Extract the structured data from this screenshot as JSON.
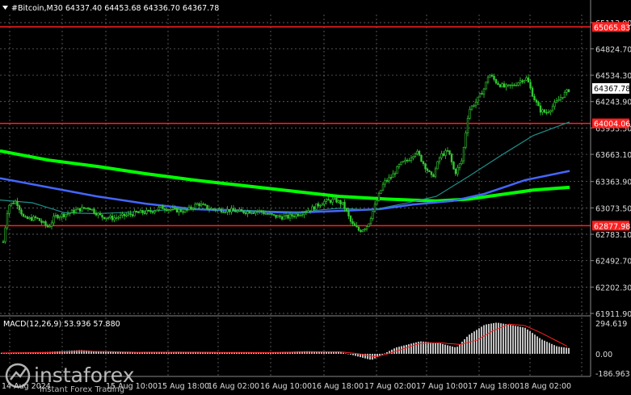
{
  "header": {
    "symbol_text": "#Bitcoin,M30  64337.40 64453.68 64336.70 64367.78",
    "macd_text": "MACD(12,26,9) 53.936 57.880"
  },
  "price_axis": {
    "labels": [
      "65113.00",
      "64824.70",
      "64534.30",
      "64243.90",
      "63953.50",
      "63663.10",
      "63363.90",
      "63073.50",
      "62783.10",
      "62492.70",
      "62202.30",
      "61911.90"
    ],
    "values": [
      65113.0,
      64824.7,
      64534.3,
      64243.9,
      63953.5,
      63663.1,
      63363.9,
      63073.5,
      62783.1,
      62492.7,
      62202.3,
      61911.9
    ],
    "current_price": "64367.78",
    "levels": [
      {
        "label": "65065.83",
        "value": 65065.83
      },
      {
        "label": "64004.06",
        "value": 64004.06
      },
      {
        "label": "62877.98",
        "value": 62877.98
      }
    ]
  },
  "macd_axis": {
    "labels": [
      "294.619",
      "0.00",
      "-186.963"
    ],
    "values": [
      294.619,
      0,
      -186.963
    ]
  },
  "time_axis": {
    "labels": [
      "14 Aug 2024",
      "15 Aug 10:00",
      "15 Aug 18:00",
      "16 Aug 02:00",
      "16 Aug 10:00",
      "16 Aug 18:00",
      "17 Aug 02:00",
      "17 Aug 10:00",
      "17 Aug 18:00",
      "18 Aug 02:00"
    ]
  },
  "watermark": {
    "brand": "instaforex",
    "tagline": "Instant Forex Trading"
  },
  "colors": {
    "background": "#000000",
    "candle": "#33cc33",
    "level": "#ff2020",
    "ma_slow": "#00ff00",
    "ma_mid": "#4466ff",
    "ma_fast": "#1f8f8a",
    "macd_hist": "#c0c0c0",
    "macd_signal": "#ff2020",
    "grid": "#777777"
  },
  "icons": {
    "menu": "triangle-down-icon",
    "logo": "instaforex-logo-icon"
  }
}
